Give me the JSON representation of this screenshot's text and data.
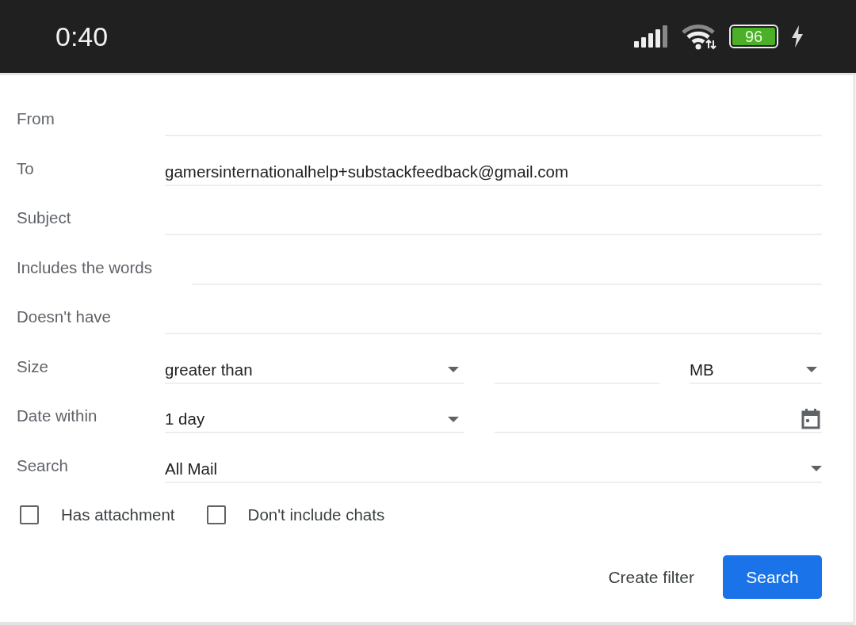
{
  "status_bar": {
    "time": "0:40",
    "battery": "96"
  },
  "fields": [
    {
      "kind": "text",
      "label": "From"
    },
    {
      "kind": "text",
      "label": "To",
      "value": "gamersinternationalhelp+substackfeedback@gmail.com"
    },
    {
      "kind": "text",
      "label": "Subject"
    },
    {
      "kind": "text",
      "label": "Includes the words"
    },
    {
      "kind": "text",
      "label": "Doesn't have"
    },
    {
      "kind": "size",
      "label": "Size",
      "operator": "greater than",
      "unit": "MB"
    },
    {
      "kind": "date",
      "label": "Date within",
      "value": "1 day"
    },
    {
      "kind": "select",
      "label": "Search",
      "value": "All Mail"
    }
  ],
  "checkboxes": [
    {
      "label": "Has attachment",
      "checked": false
    },
    {
      "label": "Don't include chats",
      "checked": false
    }
  ],
  "buttons": {
    "create_filter": "Create filter",
    "search": "Search"
  }
}
